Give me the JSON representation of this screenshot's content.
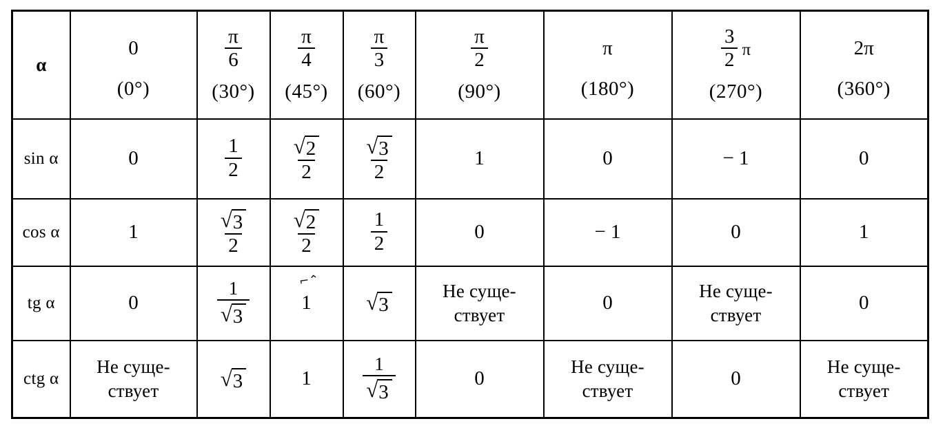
{
  "table": {
    "corner_label": "α",
    "columns": [
      {
        "radian": "0",
        "radian_type": "plain",
        "degrees": "(0°)"
      },
      {
        "radian": "π/6",
        "radian_type": "fraction",
        "num": "π",
        "den": "6",
        "degrees": "(30°)"
      },
      {
        "radian": "π/4",
        "radian_type": "fraction",
        "num": "π",
        "den": "4",
        "degrees": "(45°)"
      },
      {
        "radian": "π/3",
        "radian_type": "fraction",
        "num": "π",
        "den": "3",
        "degrees": "(60°)"
      },
      {
        "radian": "π/2",
        "radian_type": "fraction",
        "num": "π",
        "den": "2",
        "degrees": "(90°)"
      },
      {
        "radian": "π",
        "radian_type": "plain",
        "degrees": "(180°)"
      },
      {
        "radian": "3/2 π",
        "radian_type": "fraction-pi",
        "num": "3",
        "den": "2",
        "tail": "π",
        "degrees": "(270°)"
      },
      {
        "radian": "2π",
        "radian_type": "plain",
        "degrees": "(360°)"
      }
    ],
    "rows": [
      {
        "label": "sin α",
        "cells": [
          {
            "kind": "plain",
            "text": "0"
          },
          {
            "kind": "fraction",
            "num": "1",
            "den": "2"
          },
          {
            "kind": "frac-radical-num",
            "num_radicand": "2",
            "den": "2"
          },
          {
            "kind": "frac-radical-num",
            "num_radicand": "3",
            "den": "2"
          },
          {
            "kind": "plain",
            "text": "1"
          },
          {
            "kind": "plain",
            "text": "0"
          },
          {
            "kind": "plain",
            "text": "− 1"
          },
          {
            "kind": "plain",
            "text": "0"
          }
        ]
      },
      {
        "label": "cos α",
        "cells": [
          {
            "kind": "plain",
            "text": "1"
          },
          {
            "kind": "frac-radical-num",
            "num_radicand": "3",
            "den": "2"
          },
          {
            "kind": "frac-radical-num",
            "num_radicand": "2",
            "den": "2"
          },
          {
            "kind": "fraction",
            "num": "1",
            "den": "2"
          },
          {
            "kind": "plain",
            "text": "0"
          },
          {
            "kind": "plain",
            "text": "− 1"
          },
          {
            "kind": "plain",
            "text": "0"
          },
          {
            "kind": "plain",
            "text": "1"
          }
        ]
      },
      {
        "label": "tg α",
        "cells": [
          {
            "kind": "plain",
            "text": "0"
          },
          {
            "kind": "frac-radical-den",
            "num": "1",
            "den_radicand": "3"
          },
          {
            "kind": "plain",
            "text": "1",
            "artifact": "⌐‌⌃"
          },
          {
            "kind": "radical",
            "radicand": "3"
          },
          {
            "kind": "noexist",
            "text": "Не суще-\nствует"
          },
          {
            "kind": "plain",
            "text": "0"
          },
          {
            "kind": "noexist",
            "text": "Не суще-\nствует"
          },
          {
            "kind": "plain",
            "text": "0"
          }
        ]
      },
      {
        "label": "ctg α",
        "cells": [
          {
            "kind": "noexist",
            "text": "Не суще-\nствует"
          },
          {
            "kind": "radical",
            "radicand": "3"
          },
          {
            "kind": "plain",
            "text": "1"
          },
          {
            "kind": "frac-radical-den",
            "num": "1",
            "den_radicand": "3"
          },
          {
            "kind": "plain",
            "text": "0"
          },
          {
            "kind": "noexist",
            "text": "Не суще-\nствует"
          },
          {
            "kind": "plain",
            "text": "0"
          },
          {
            "kind": "noexist",
            "text": "Не суще-\nствует"
          }
        ]
      }
    ]
  },
  "colors": {
    "ink": "#000000",
    "paper": "#ffffff"
  }
}
